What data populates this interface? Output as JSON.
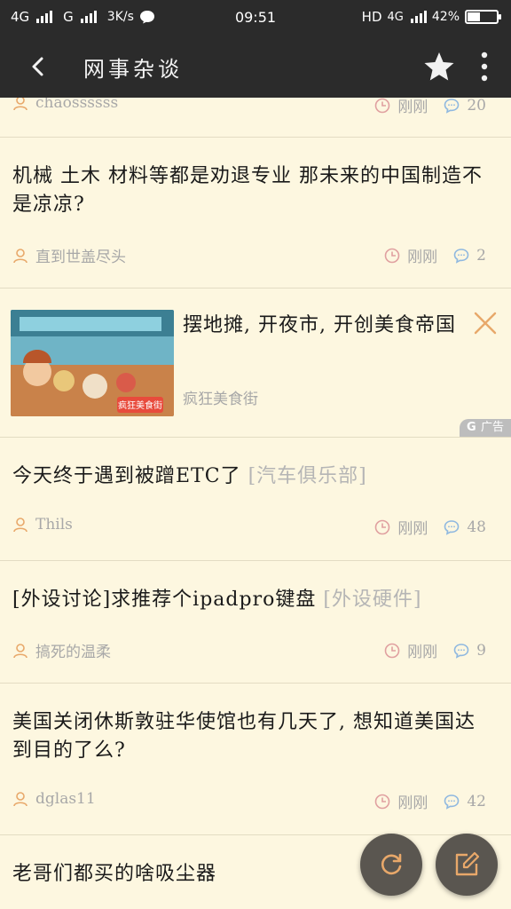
{
  "status_bar": {
    "net1": "4G",
    "net2": "G",
    "speed": "3K/s",
    "time": "09:51",
    "hd": "HD",
    "net3": "4G",
    "battery": "42%",
    "battery_level": 0.42
  },
  "app_bar": {
    "title": "网事杂谈"
  },
  "feed": {
    "partial_item": {
      "author": "chaossssss",
      "time": "刚刚",
      "replies": "20"
    },
    "items": [
      {
        "title": "机械 土木 材料等都是劝退专业 那未来的中国制造不是凉凉?",
        "forum": "",
        "author": "直到世盖尽头",
        "time": "刚刚",
        "replies": "2"
      },
      {
        "title": "今天终于遇到被蹭ETC了",
        "forum": "[汽车俱乐部]",
        "author": "Thils",
        "time": "刚刚",
        "replies": "48"
      },
      {
        "title": "[外设讨论]求推荐个ipadpro键盘",
        "forum": "[外设硬件]",
        "author": "搞死的温柔",
        "time": "刚刚",
        "replies": "9"
      },
      {
        "title": "美国关闭休斯敦驻华使馆也有几天了, 想知道美国达到目的了么?",
        "forum": "",
        "author": "dglas11",
        "time": "刚刚",
        "replies": "42"
      },
      {
        "title": "老哥们都买的啥吸尘器",
        "forum": ""
      }
    ],
    "ad": {
      "title": "摆地摊, 开夜市, 开创美食帝国",
      "source": "疯狂美食街",
      "tag": "广告",
      "image_text": "疯狂美食街"
    }
  },
  "colors": {
    "background": "#fdf7e0",
    "bar": "#2b2b2b",
    "accent": "#e8a86a",
    "clock_icon": "#e0a0a0",
    "comment_icon": "#8fb8e0"
  }
}
